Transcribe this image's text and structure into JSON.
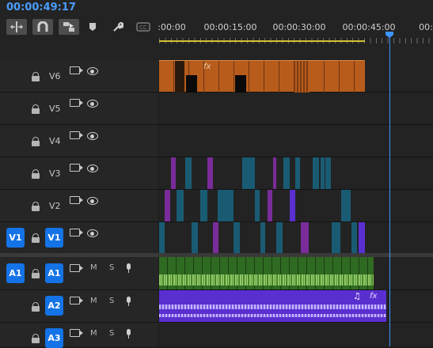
{
  "timecode": "00:00:49:17",
  "ruler": {
    "labels": [
      ":00:00",
      "00:00:15:00",
      "00:00:30:00",
      "00:00:45:00",
      "00:"
    ]
  },
  "tools": [
    {
      "name": "insert-edit-icon",
      "glyph": "⇹"
    },
    {
      "name": "snap-icon",
      "glyph": "∩"
    },
    {
      "name": "linked-selection-icon",
      "glyph": "⛶"
    },
    {
      "name": "marker-icon",
      "glyph": "⬥"
    },
    {
      "name": "wrench-icon",
      "glyph": "🔧"
    },
    {
      "name": "captions-icon",
      "glyph": "CC"
    }
  ],
  "tracks": {
    "v6": "V6",
    "v5": "V5",
    "v4": "V4",
    "v3": "V3",
    "v2": "V2",
    "v1": "V1",
    "a1": "A1",
    "a2": "A2",
    "a3": "A3"
  },
  "source_patch": {
    "v1": "V1",
    "a1": "A1"
  },
  "audio_buttons": {
    "mute": "M",
    "solo": "S"
  },
  "clip_labels": {
    "fx": "fx",
    "audio_fx": "fx",
    "music_note": "♫"
  },
  "colors": {
    "accent": "#1473e6",
    "playhead": "#3d95ff",
    "v6_clip": "#b85c1c",
    "broll_clip": "#1a5b74",
    "transition_clip": "#7a2c9a",
    "a1_clip": "#3a7a2a",
    "a2_clip": "#5a2fd0"
  }
}
